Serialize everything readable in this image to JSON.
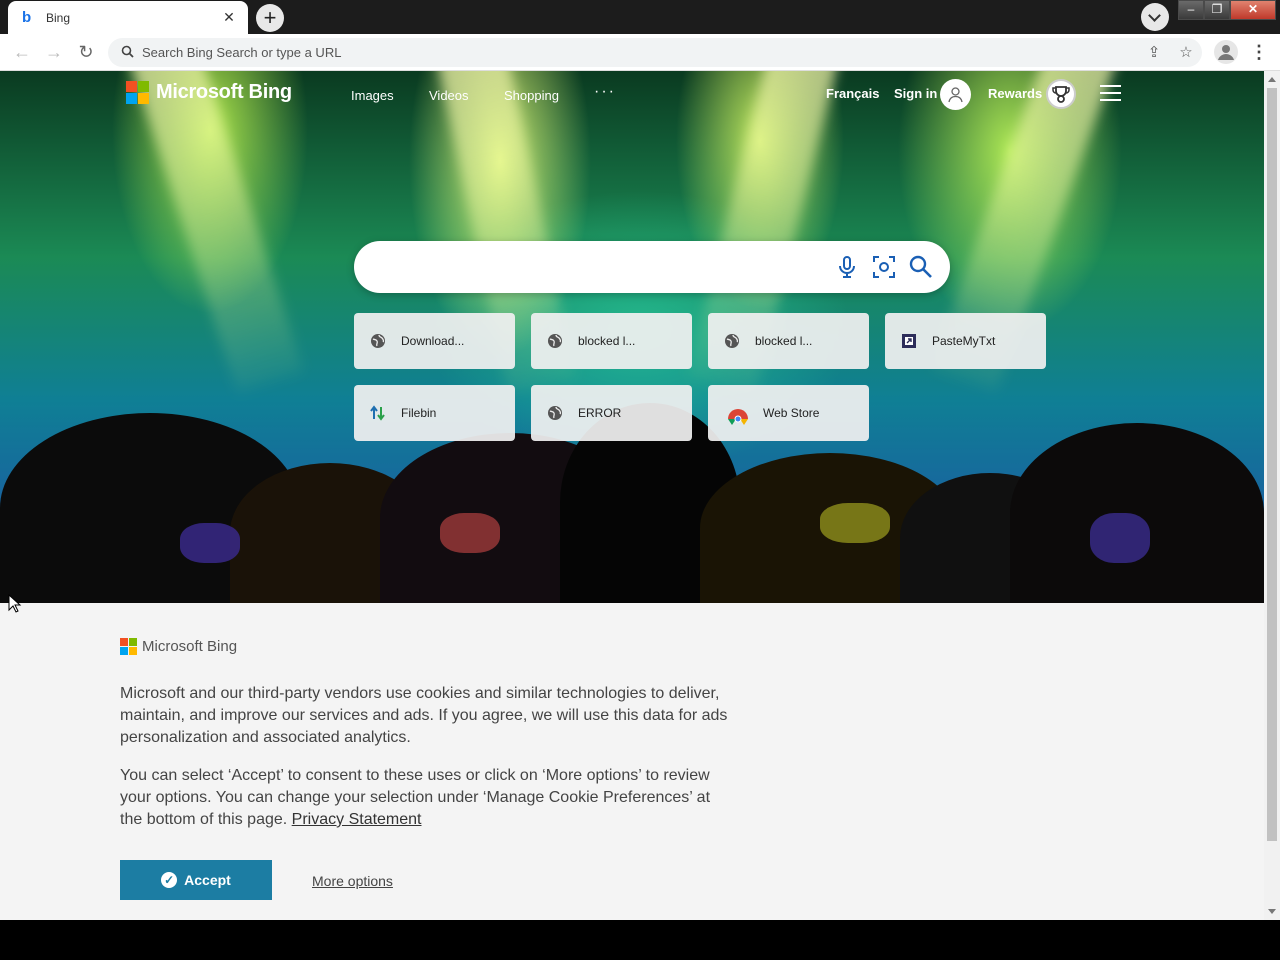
{
  "browser": {
    "tab_title": "Bing",
    "tab_close": "✕",
    "new_tab": "+",
    "omnibox_placeholder": "Search Bing Search or type a URL"
  },
  "header": {
    "logo_text": "Microsoft Bing",
    "nav": [
      "Images",
      "Videos",
      "Shopping"
    ],
    "more": "···",
    "language": "Français",
    "sign_in": "Sign in",
    "rewards": "Rewards"
  },
  "search": {
    "value": "",
    "icons": [
      "microphone-icon",
      "visual-search-icon",
      "search-icon"
    ]
  },
  "quick_links": [
    {
      "label": "Download...",
      "icon": "globe-icon"
    },
    {
      "label": "blocked l...",
      "icon": "globe-icon"
    },
    {
      "label": "blocked l...",
      "icon": "globe-icon"
    },
    {
      "label": "PasteMyTxt",
      "icon": "pastemytxt-icon"
    },
    {
      "label": "Filebin",
      "icon": "filebin-icon"
    },
    {
      "label": "ERROR",
      "icon": "globe-icon"
    },
    {
      "label": "Web Store",
      "icon": "chrome-icon"
    }
  ],
  "cookie": {
    "logo_text": "Microsoft Bing",
    "paragraph1": "Microsoft and our third-party vendors use cookies and similar technologies to deliver, maintain, and improve our services and ads. If you agree, we will use this data for ads personalization and associated analytics.",
    "paragraph2": "You can select ‘Accept’ to consent to these uses or click on ‘More options’ to review your options.  You can change your selection under ‘Manage Cookie Preferences’ at the bottom of this page. ",
    "privacy_link": "Privacy Statement",
    "accept": "Accept",
    "more_options": "More options"
  },
  "colors": {
    "accept_button": "#1c7da3",
    "ms_red": "#f25022",
    "ms_green": "#7fba00",
    "ms_blue": "#00a4ef",
    "ms_yellow": "#ffb900"
  }
}
